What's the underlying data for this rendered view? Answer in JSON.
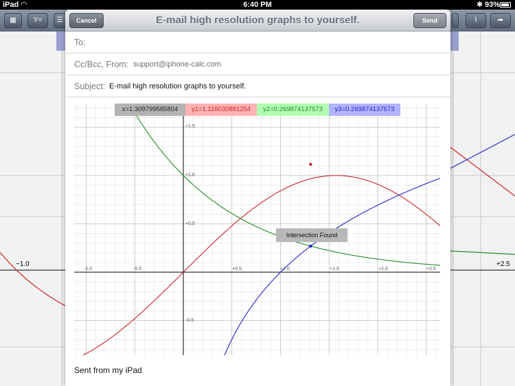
{
  "status_bar": {
    "carrier": "iPad",
    "time": "6:40 PM",
    "battery": "93%"
  },
  "background_app": {
    "toolbar": {
      "equation_button": "Y="
    },
    "x_ticks": {
      "left": "−1.0",
      "right": "+2.5"
    }
  },
  "mail": {
    "title": "E-mail high resolution graphs to yourself.",
    "cancel_label": "Cancel",
    "send_label": "Send",
    "to_label": "To:",
    "ccbcc_label": "Cc/Bcc, From:",
    "from_value": "support@iphone-calc.com",
    "subject_label": "Subject:",
    "subject_value": "E-mail high resolution graphs to yourself.",
    "signature": "Sent from my iPad"
  },
  "graph": {
    "readouts": {
      "x": "x=1.309799585804",
      "y1": "y1=1.116030881254",
      "y2": "y2=0.269874137573",
      "y3": "y3=0.269874137573"
    },
    "colors": {
      "y1": "#cc2222",
      "y2": "#228822",
      "y3": "#2222cc",
      "x_bg": "#b3b3b3",
      "y1_bg": "#ffb3b3",
      "y2_bg": "#b3ffb3",
      "y3_bg": "#b3b3ff"
    },
    "x_ticks": [
      "-1.0",
      "-0.5",
      "+0.5",
      "+1.0",
      "+1.5",
      "+2.0",
      "+2.5"
    ],
    "y_ticks": [
      "+1.5",
      "+1.0",
      "+0.5",
      "-0.5"
    ],
    "intersection_label": "Intersection Found"
  },
  "icons": [
    "calculator-icon",
    "list-icon",
    "graph-icon",
    "share-icon",
    "wifi-icon",
    "bluetooth-icon"
  ]
}
